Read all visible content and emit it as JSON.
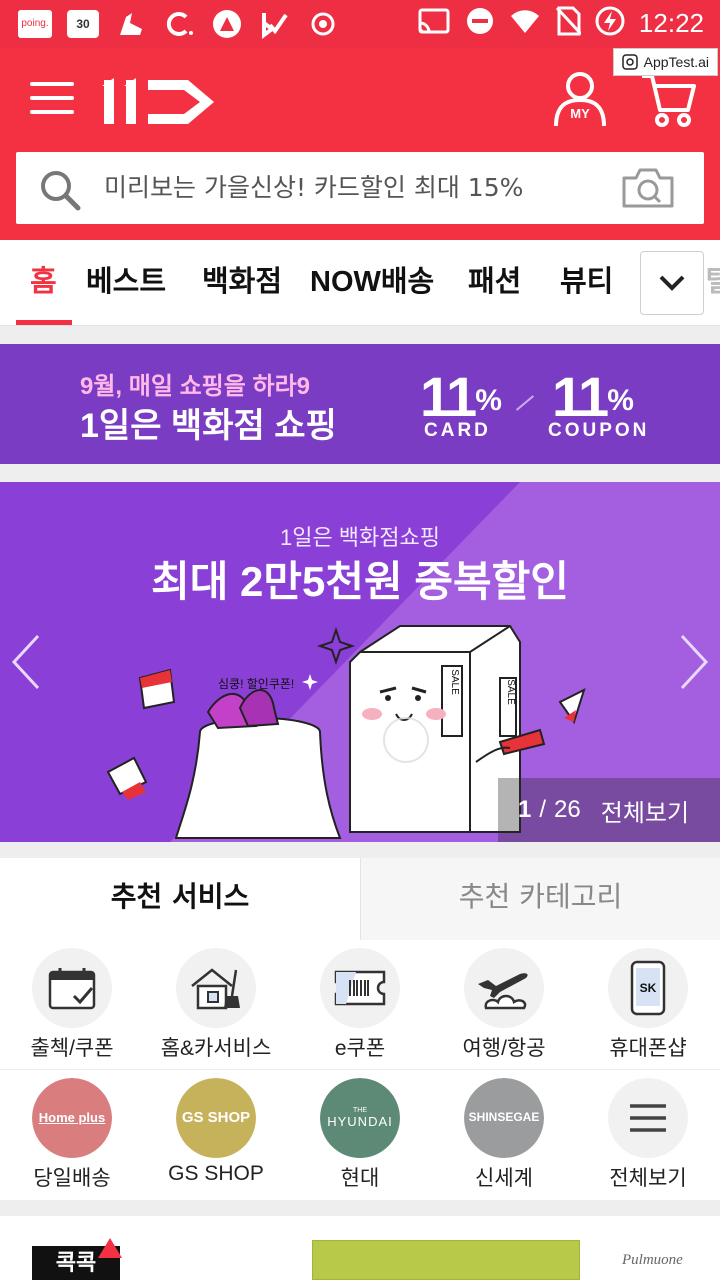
{
  "status_bar": {
    "time": "12:22",
    "badge_30": "30",
    "poing_label": "poing."
  },
  "watermark": {
    "label": "AppTest.ai"
  },
  "header": {
    "logo_text": "11",
    "my_label": "MY",
    "search_placeholder": "미리보는 가을신상! 카드할인 최대 15%"
  },
  "tabs": {
    "items": [
      "홈",
      "베스트",
      "백화점",
      "NOW배송",
      "패션",
      "뷰티",
      "디지털"
    ],
    "active_index": 0
  },
  "promo": {
    "subtitle": "9월, 매일 쇼핑을 하라9",
    "title": "1일은 백화점 쇼핑",
    "card_value": "11",
    "card_unit": "%",
    "card_label": "CARD",
    "coupon_value": "11",
    "coupon_unit": "%",
    "coupon_label": "COUPON"
  },
  "hero": {
    "subtitle": "1일은 백화점쇼핑",
    "title": "최대 2만5천원 중복할인",
    "speech": "심쿵! 할인쿠폰!",
    "sale_text": "SALE",
    "page_current": "1",
    "page_separator": "/",
    "page_total": "26",
    "view_all": "전체보기"
  },
  "service_tabs": {
    "recommended_services": "추천 서비스",
    "recommended_categories": "추천 카테고리"
  },
  "services_row1": [
    {
      "label": "출첵/쿠폰",
      "icon": "calendar-check-icon"
    },
    {
      "label": "홈&카서비스",
      "icon": "house-broom-icon"
    },
    {
      "label": "e쿠폰",
      "icon": "barcode-ticket-icon"
    },
    {
      "label": "여행/항공",
      "icon": "airplane-icon"
    },
    {
      "label": "휴대폰샵",
      "icon": "phone-sk-icon"
    }
  ],
  "services_row2": [
    {
      "label": "당일배송",
      "brand": "Home plus",
      "color": "#d97d7e"
    },
    {
      "label": "GS SHOP",
      "brand": "GS SHOP",
      "color": "#c7b25c"
    },
    {
      "label": "현대",
      "brand_top": "THE",
      "brand": "HYUNDAI",
      "color": "#5c8a76"
    },
    {
      "label": "신세계",
      "brand": "SHINSEGAE",
      "color": "#9a9c9d"
    },
    {
      "label": "전체보기",
      "icon": "menu-lines-icon"
    }
  ],
  "sk_text": "SK",
  "bottom": {
    "logo_text": "콕콕",
    "pulmuone": "Pulmuone"
  },
  "colors": {
    "brand_red": "#f43142",
    "promo_purple": "#7b3cc4",
    "hero_purple": "#8a3fd6"
  }
}
